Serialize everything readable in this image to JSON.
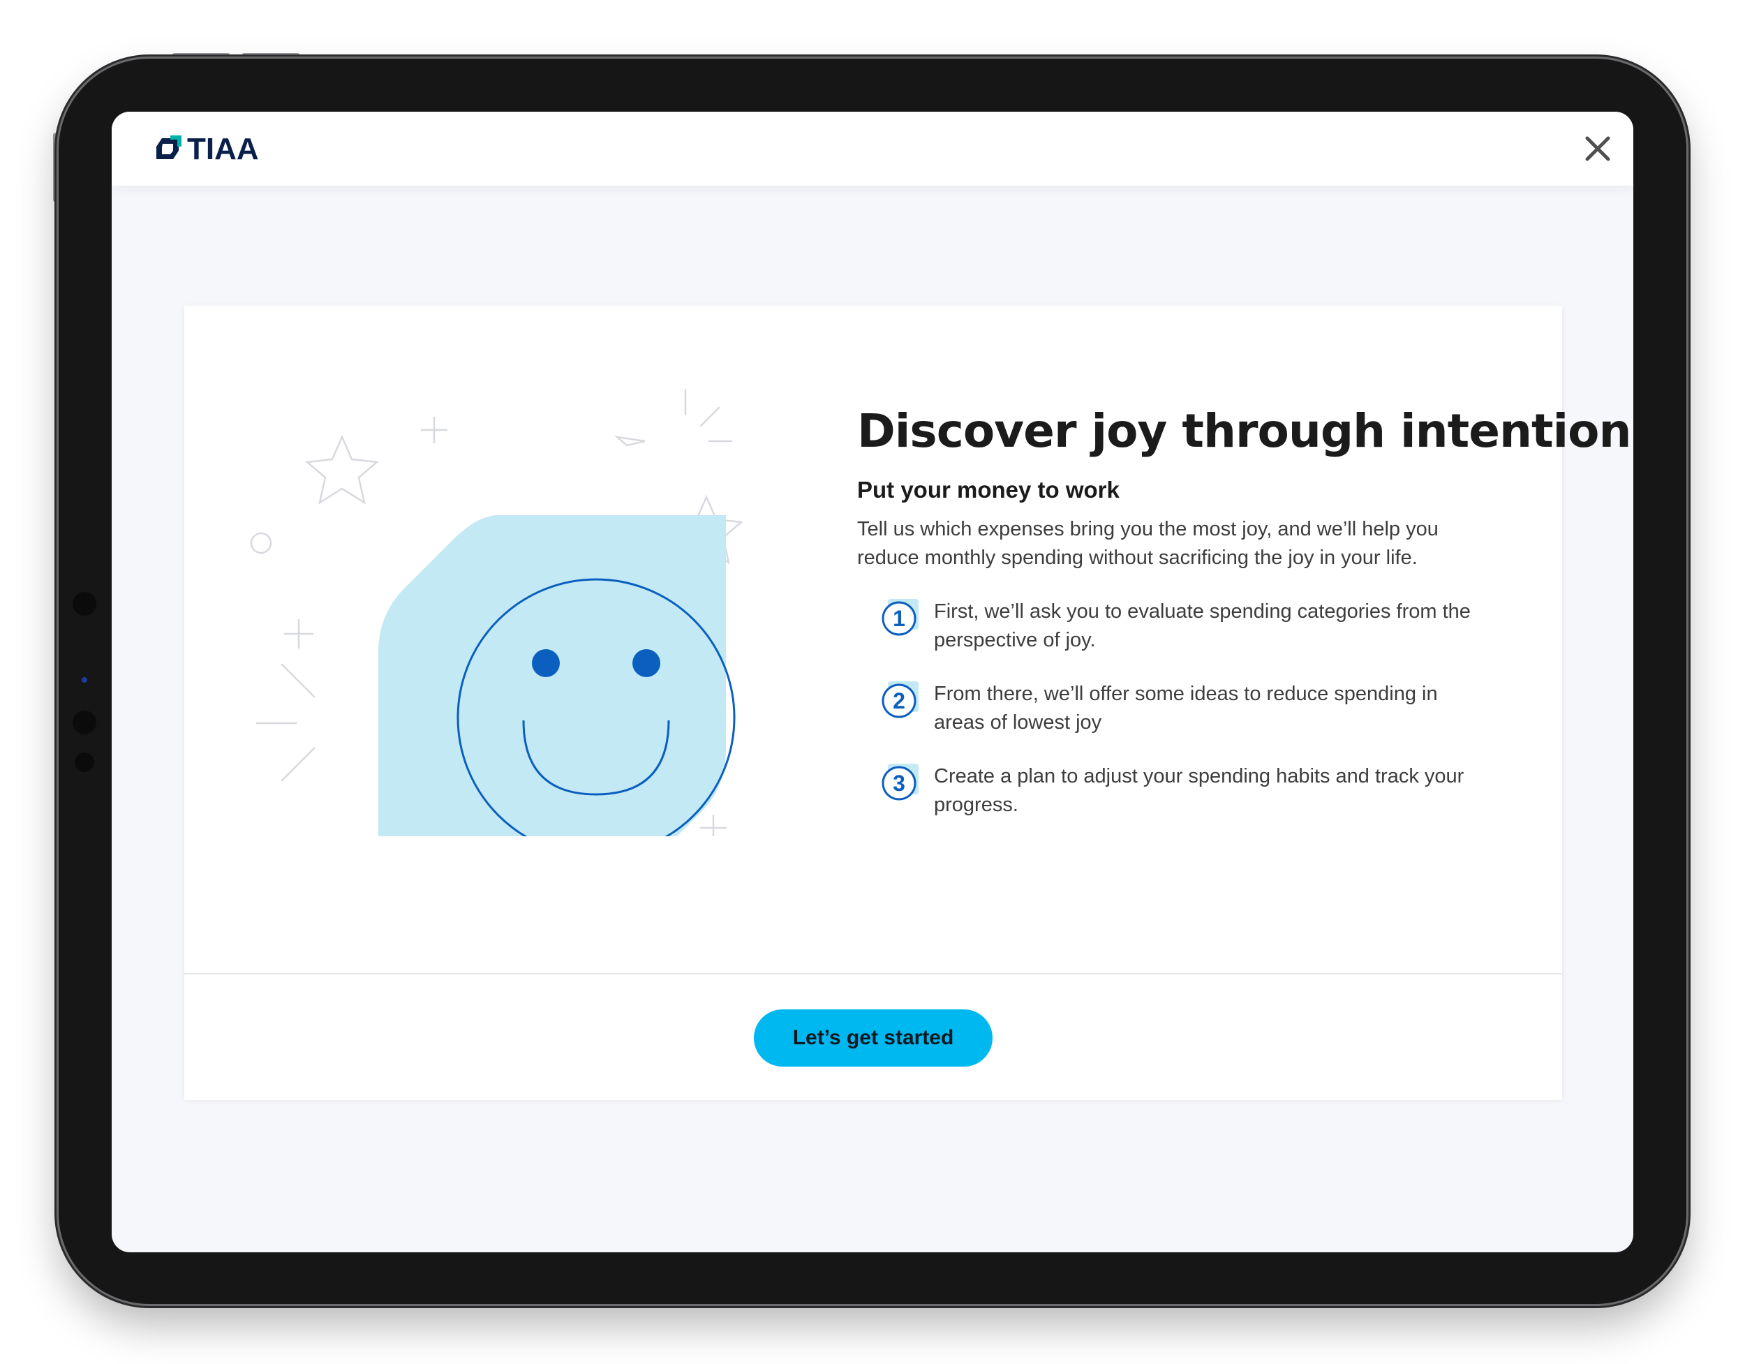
{
  "brand": {
    "name": "TIAA",
    "colors": {
      "navy": "#0a1f49",
      "accent": "#00b8f0",
      "icon_blue": "#0a5fbf",
      "illustration_fill": "#c3e9f5"
    }
  },
  "header": {
    "logo_text": "TIAA",
    "logo_icon": "tiaa-logo-mark",
    "close_icon": "close-icon"
  },
  "content": {
    "illustration": "smiley-face-illustration",
    "title": "Discover joy through intention",
    "subtitle": "Put your money to work",
    "intro": "Tell us which expenses bring you the most joy, and we’ll help you reduce monthly spending without sacrificing the joy in your life.",
    "steps": [
      {
        "number": "1",
        "text": "First, we’ll ask you to evaluate spending categories from the perspective of joy."
      },
      {
        "number": "2",
        "text": "From there, we’ll offer some ideas to reduce spending in areas of lowest joy"
      },
      {
        "number": "3",
        "text": "Create a plan to adjust your spending habits and track your progress."
      }
    ]
  },
  "footer": {
    "cta_label": "Let’s get started"
  }
}
